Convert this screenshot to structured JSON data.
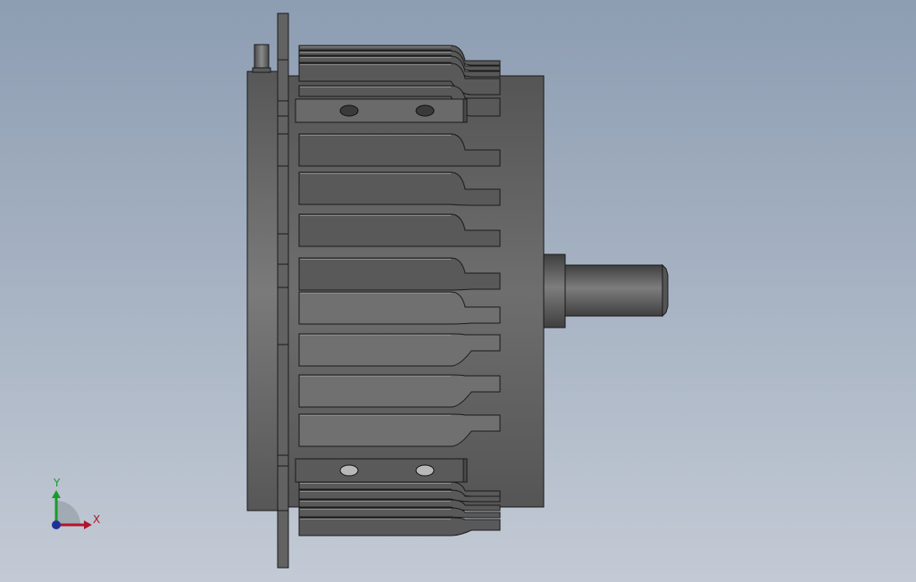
{
  "triad": {
    "x_label": "X",
    "y_label": "Y",
    "x_color": "#b0162a",
    "y_color": "#1a9a2a",
    "z_color": "#1f2f9a"
  },
  "colors": {
    "background_top": "#8d9db2",
    "background_bottom": "#c3cad5",
    "body": "#6b6b6b",
    "body_dark": "#4d4d4d",
    "fin": "#595959",
    "fin_light": "#777777",
    "edge": "#1a1a1a",
    "shaft": "#6a6a6a"
  }
}
